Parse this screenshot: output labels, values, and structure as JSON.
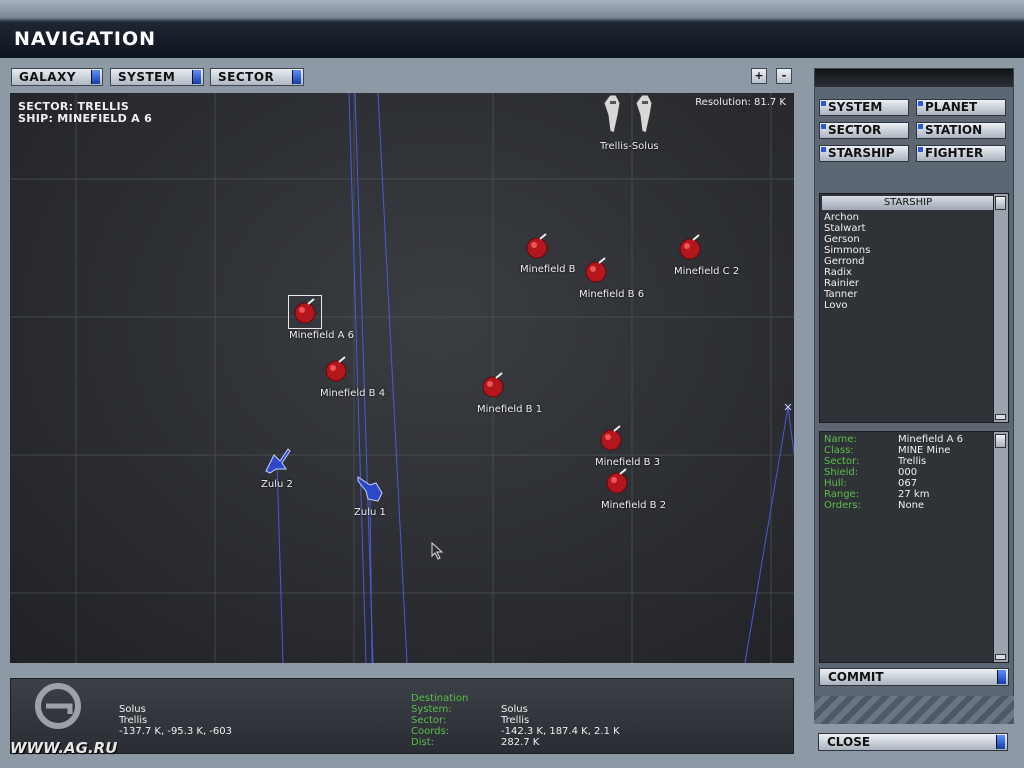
{
  "window": {
    "title": "NAVIGATION"
  },
  "toolbar": {
    "view_buttons": [
      "GALAXY",
      "SYSTEM",
      "SECTOR"
    ],
    "zoom_in": "+",
    "zoom_out": "-"
  },
  "map": {
    "sector_line": "SECTOR: TRELLIS",
    "ship_line": "SHIP: MINEFIELD A 6",
    "resolution": "Resolution: 81.7 K",
    "objects": {
      "station": "Trellis-Solus",
      "mf_b": "Minefield B",
      "mf_b6": "Minefield B 6",
      "mf_c2": "Minefield C 2",
      "mf_a6": "Minefield A 6",
      "mf_b4": "Minefield B 4",
      "mf_b1": "Minefield B 1",
      "mf_b3": "Minefield B 3",
      "mf_b2": "Minefield B 2",
      "zulu2": "Zulu 2",
      "zulu1": "Zulu 1"
    }
  },
  "categories": {
    "system": "SYSTEM",
    "planet": "PLANET",
    "sector": "SECTOR",
    "station": "STATION",
    "starship": "STARSHIP",
    "fighter": "FIGHTER"
  },
  "starship_list": {
    "header": "STARSHIP",
    "items": [
      "Archon",
      "Stalwart",
      "Gerson",
      "Simmons",
      "Gerrond",
      "Radix",
      "Rainier",
      "Tanner",
      "Lovo"
    ]
  },
  "details": {
    "rows": [
      {
        "key": "Name:",
        "value": "Minefield A 6"
      },
      {
        "key": "Class:",
        "value": "MINE Mine"
      },
      {
        "key": "Sector:",
        "value": "Trellis"
      },
      {
        "key": "Shield:",
        "value": "000"
      },
      {
        "key": "Hull:",
        "value": "067"
      },
      {
        "key": "Range:",
        "value": "27 km"
      },
      {
        "key": "Orders:",
        "value": "None"
      }
    ]
  },
  "buttons": {
    "commit": "COMMIT",
    "close": "CLOSE"
  },
  "origin": {
    "system": "Solus",
    "sector": "Trellis",
    "coords": "-137.7 K, -95.3 K, -603"
  },
  "destination": {
    "title": "Destination",
    "system_label": "System:",
    "sector_label": "Sector:",
    "coords_label": "Coords:",
    "dist_label": "Dist:",
    "system": "Solus",
    "sector": "Trellis",
    "coords": "-142.3 K, 187.4 K, 2.1 K",
    "dist": "282.7 K"
  },
  "watermark": "WWW.AG.RU",
  "colors": {
    "mine_red": "#b3161c",
    "fighter_blue": "#2d49c9",
    "label_green": "#5dbd4a",
    "button_blue": "#1f4fd0"
  }
}
